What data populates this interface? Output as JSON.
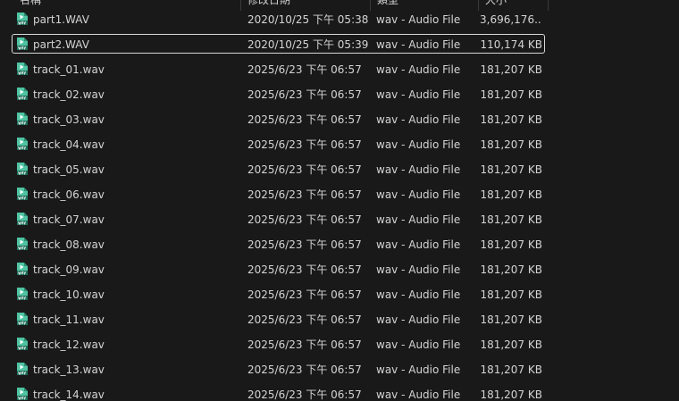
{
  "columns": {
    "name": "名稱",
    "date": "修改日期",
    "type": "類型",
    "size": "大小"
  },
  "icon": "wav-audio-file-icon",
  "files": [
    {
      "name": "part1.WAV",
      "date": "2020/10/25 下午 05:38",
      "type": "wav - Audio File",
      "size": "3,696,176..."
    },
    {
      "name": "part2.WAV",
      "date": "2020/10/25 下午 05:39",
      "type": "wav - Audio File",
      "size": "110,174 KB"
    },
    {
      "name": "track_01.wav",
      "date": "2025/6/23 下午 06:57",
      "type": "wav - Audio File",
      "size": "181,207 KB"
    },
    {
      "name": "track_02.wav",
      "date": "2025/6/23 下午 06:57",
      "type": "wav - Audio File",
      "size": "181,207 KB"
    },
    {
      "name": "track_03.wav",
      "date": "2025/6/23 下午 06:57",
      "type": "wav - Audio File",
      "size": "181,207 KB"
    },
    {
      "name": "track_04.wav",
      "date": "2025/6/23 下午 06:57",
      "type": "wav - Audio File",
      "size": "181,207 KB"
    },
    {
      "name": "track_05.wav",
      "date": "2025/6/23 下午 06:57",
      "type": "wav - Audio File",
      "size": "181,207 KB"
    },
    {
      "name": "track_06.wav",
      "date": "2025/6/23 下午 06:57",
      "type": "wav - Audio File",
      "size": "181,207 KB"
    },
    {
      "name": "track_07.wav",
      "date": "2025/6/23 下午 06:57",
      "type": "wav - Audio File",
      "size": "181,207 KB"
    },
    {
      "name": "track_08.wav",
      "date": "2025/6/23 下午 06:57",
      "type": "wav - Audio File",
      "size": "181,207 KB"
    },
    {
      "name": "track_09.wav",
      "date": "2025/6/23 下午 06:57",
      "type": "wav - Audio File",
      "size": "181,207 KB"
    },
    {
      "name": "track_10.wav",
      "date": "2025/6/23 下午 06:57",
      "type": "wav - Audio File",
      "size": "181,207 KB"
    },
    {
      "name": "track_11.wav",
      "date": "2025/6/23 下午 06:57",
      "type": "wav - Audio File",
      "size": "181,207 KB"
    },
    {
      "name": "track_12.wav",
      "date": "2025/6/23 下午 06:57",
      "type": "wav - Audio File",
      "size": "181,207 KB"
    },
    {
      "name": "track_13.wav",
      "date": "2025/6/23 下午 06:57",
      "type": "wav - Audio File",
      "size": "181,207 KB"
    },
    {
      "name": "track_14.wav",
      "date": "2025/6/23 下午 06:57",
      "type": "wav - Audio File",
      "size": "181,207 KB"
    }
  ],
  "selected_index": 1,
  "colors": {
    "background": "#191919",
    "text": "#d4d4d4",
    "icon_body": "#4fc3a1",
    "icon_dark": "#2a8f74"
  }
}
